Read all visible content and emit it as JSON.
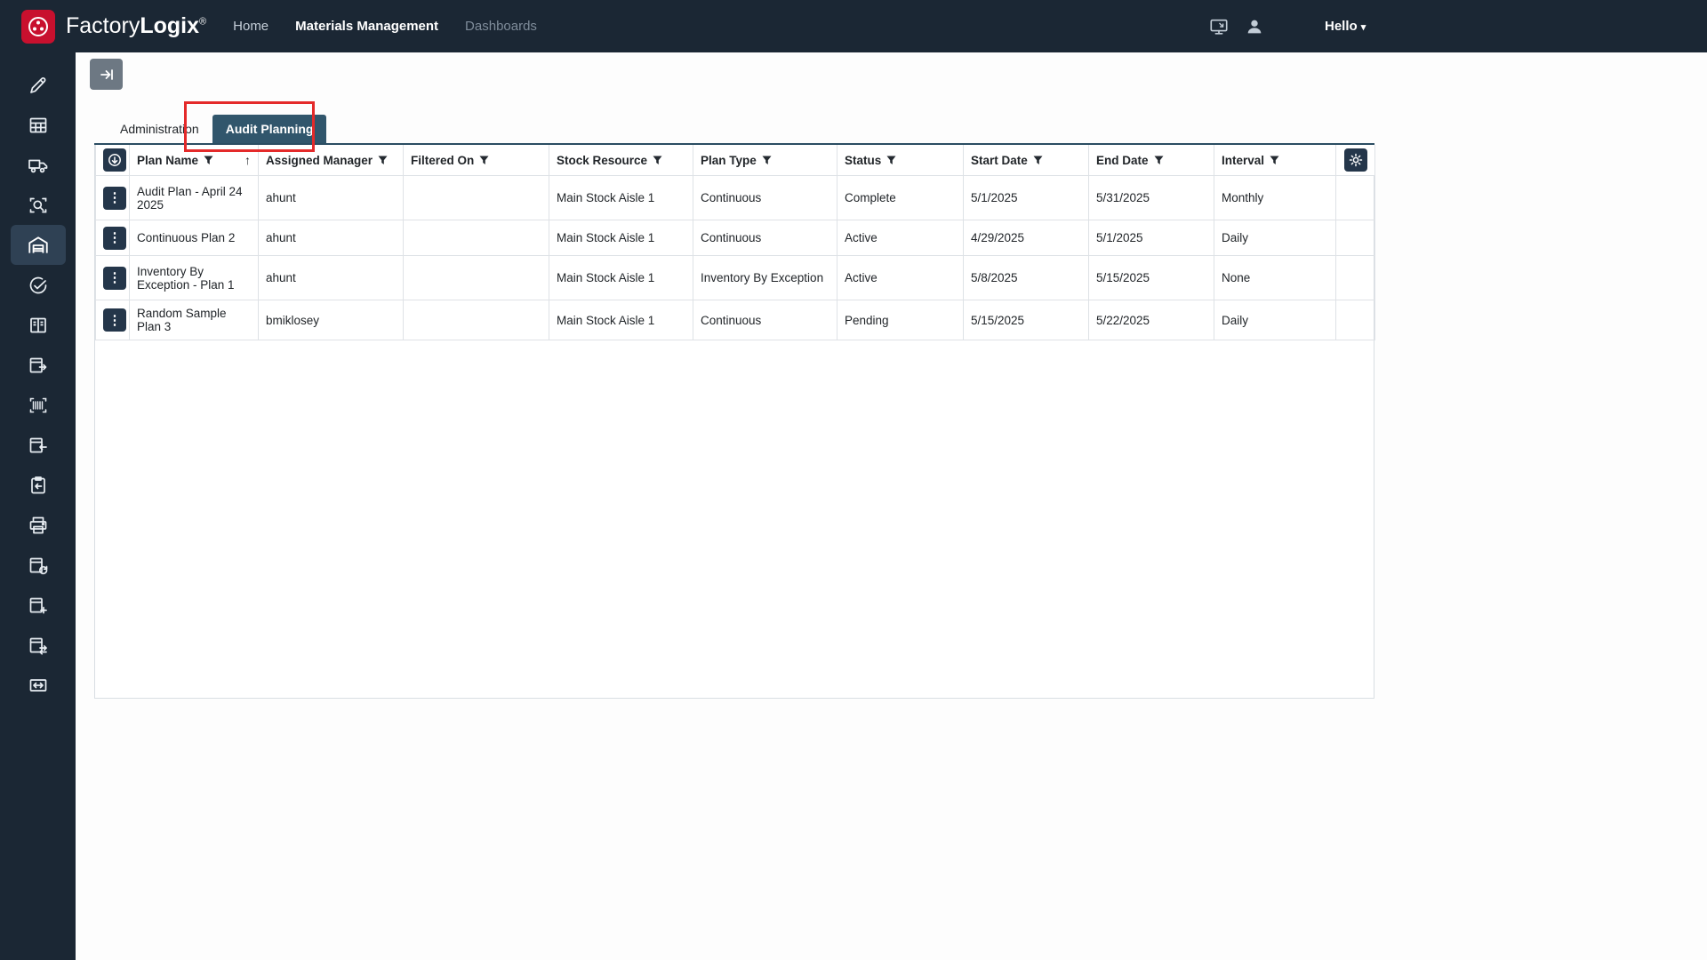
{
  "topbar": {
    "brand_regular": "Factory",
    "brand_bold": "Logix",
    "brand_registered": "®",
    "nav": [
      {
        "label": "Home"
      },
      {
        "label": "Materials Management"
      },
      {
        "label": "Dashboards"
      }
    ],
    "greeting": "Hello",
    "caret": "▾"
  },
  "sidebar": {
    "icons": [
      "edit",
      "table-grid",
      "delivery-truck",
      "scan-search",
      "warehouse",
      "audit-check",
      "documents",
      "table-export",
      "barcode",
      "table-import",
      "clipboard-return",
      "printer",
      "table-refresh",
      "table-add",
      "table-transfer",
      "table-resize"
    ],
    "active_icon": "warehouse"
  },
  "tabs": [
    {
      "label": "Administration",
      "active": false
    },
    {
      "label": "Audit Planning",
      "active": true
    }
  ],
  "table": {
    "sort_glyph": "↑",
    "row_menu_glyph": "⋮",
    "headers": [
      {
        "label": "Plan Name",
        "filter": true,
        "sorted": "asc"
      },
      {
        "label": "Assigned Manager",
        "filter": true
      },
      {
        "label": "Filtered On",
        "filter": true
      },
      {
        "label": "Stock Resource",
        "filter": true
      },
      {
        "label": "Plan Type",
        "filter": true
      },
      {
        "label": "Status",
        "filter": true
      },
      {
        "label": "Start Date",
        "filter": true
      },
      {
        "label": "End Date",
        "filter": true
      },
      {
        "label": "Interval",
        "filter": true
      }
    ],
    "rows": [
      {
        "plan_name": "Audit Plan - April 24 2025",
        "assigned_manager": "ahunt",
        "filtered_on": "",
        "stock_resource": "Main Stock Aisle 1",
        "plan_type": "Continuous",
        "status": "Complete",
        "start_date": "5/1/2025",
        "end_date": "5/31/2025",
        "interval": "Monthly"
      },
      {
        "plan_name": "Continuous Plan 2",
        "assigned_manager": "ahunt",
        "filtered_on": "",
        "stock_resource": "Main Stock Aisle 1",
        "plan_type": "Continuous",
        "status": "Active",
        "start_date": "4/29/2025",
        "end_date": "5/1/2025",
        "interval": "Daily"
      },
      {
        "plan_name": "Inventory By Exception - Plan 1",
        "assigned_manager": "ahunt",
        "filtered_on": "",
        "stock_resource": "Main Stock Aisle 1",
        "plan_type": "Inventory By Exception",
        "status": "Active",
        "start_date": "5/8/2025",
        "end_date": "5/15/2025",
        "interval": "None"
      },
      {
        "plan_name": "Random Sample Plan 3",
        "assigned_manager": "bmiklosey",
        "filtered_on": "",
        "stock_resource": "Main Stock Aisle 1",
        "plan_type": "Continuous",
        "status": "Pending",
        "start_date": "5/15/2025",
        "end_date": "5/22/2025",
        "interval": "Daily"
      }
    ]
  },
  "colors": {
    "navy": "#1b2734",
    "active_tab": "#31566c",
    "annotation_red": "#e42a2a",
    "logo_red": "#c8102e",
    "grid_border": "#dee2e6"
  }
}
